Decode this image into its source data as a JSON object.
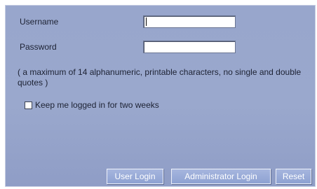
{
  "form": {
    "username_label": "Username",
    "password_label": "Password",
    "username_value": "",
    "password_value": "",
    "hint": "( a maximum of 14 alphanumeric, printable characters, no single and double quotes )",
    "keep_logged_in_label": "Keep me logged in for two weeks",
    "keep_logged_in_checked": false
  },
  "buttons": {
    "user_login": "User Login",
    "admin_login": "Administrator Login",
    "reset": "Reset"
  },
  "colors": {
    "panel_background": "#98a6cc",
    "button_background": "#9aaed8",
    "button_text": "#ffffff"
  }
}
